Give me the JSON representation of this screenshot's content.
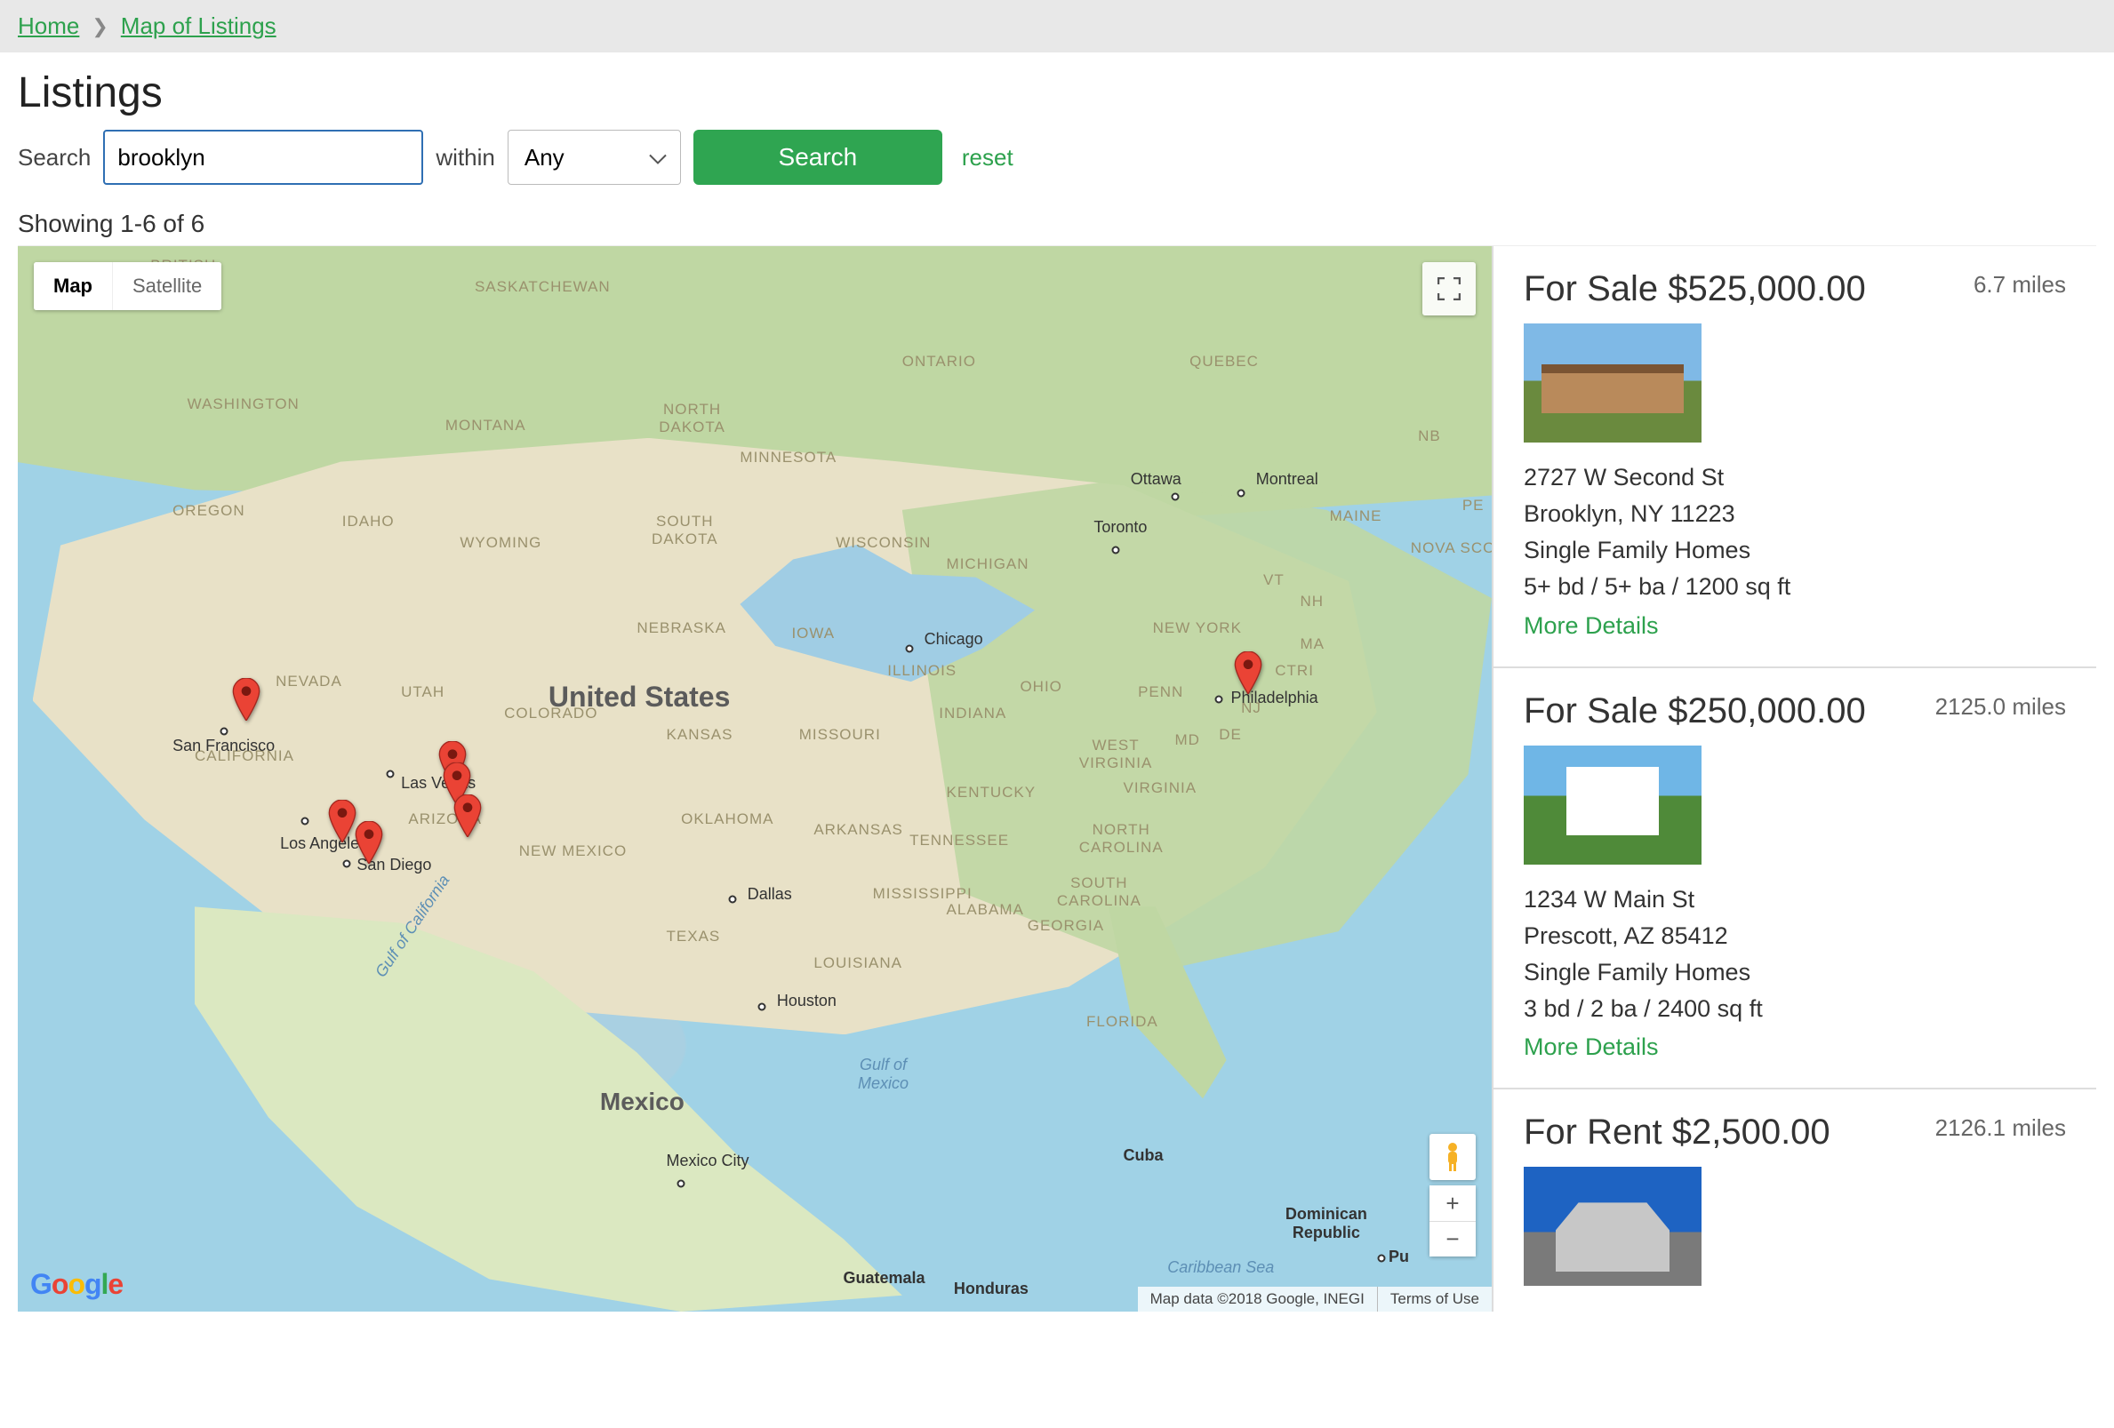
{
  "breadcrumb": {
    "home": "Home",
    "current": "Map of Listings"
  },
  "page_title": "Listings",
  "search": {
    "label": "Search",
    "value": "brooklyn",
    "within_label": "within",
    "within_value": "Any",
    "button": "Search",
    "reset": "reset"
  },
  "result_count": "Showing 1-6 of 6",
  "map": {
    "type_map": "Map",
    "type_sat": "Satellite",
    "attribution": "Map data ©2018 Google, INEGI",
    "terms": "Terms of Use",
    "labels": {
      "british_columbia": "BRITISH\n      BIA",
      "sask": "SASKATCHEWAN",
      "ontario": "ONTARIO",
      "quebec": "QUEBEC",
      "nb": "NB",
      "pe": "PE",
      "maine": "MAINE",
      "nova": "NOVA SCO",
      "wash": "WASHINGTON",
      "mont": "MONTANA",
      "ndak": "NORTH\nDAKOTA",
      "minn": "MINNESOTA",
      "ore": "OREGON",
      "idaho": "IDAHO",
      "wyo": "WYOMING",
      "sdak": "SOUTH\nDAKOTA",
      "wisc": "WISCONSIN",
      "mich": "MICHIGAN",
      "vt": "VT",
      "nh": "NH",
      "ny": "NEW YORK",
      "ma": "MA",
      "ctri": "CTRI",
      "nev": "NEVADA",
      "utah": "UTAH",
      "colo": "COLORADO",
      "neb": "NEBRASKA",
      "iowa": "IOWA",
      "ohio": "OHIO",
      "penn": "PENN",
      "nj": "NJ",
      "de": "DE",
      "cal": "CALIFORNIA",
      "kan": "KANSAS",
      "mo": "MISSOURI",
      "ill": "ILLINOIS",
      "ind": "INDIANA",
      "wv": "WEST\nVIRGINIA",
      "va": "VIRGINIA",
      "md": "MD",
      "ari": "ARIZONA",
      "nm": "NEW MEXICO",
      "ok": "OKLAHOMA",
      "ark": "ARKANSAS",
      "tenn": "TENNESSEE",
      "ky": "KENTUCKY",
      "nc": "NORTH\nCAROLINA",
      "sc": "SOUTH\nCAROLINA",
      "tx": "TEXAS",
      "miss": "MISSISSIPPI",
      "alab": "ALABAMA",
      "ga": "GEORGIA",
      "la": "LOUISIANA",
      "fl": "FLORIDA",
      "usa": "United States",
      "mexico": "Mexico",
      "gulf_mex": "Gulf of\nMexico",
      "gulf_cal": "Gulf of California",
      "carib": "Caribbean Sea",
      "sf": "San Francisco",
      "la_city": "Los Angeles",
      "sd": "San Diego",
      "lv": "Las Vegas",
      "chic": "Chicago",
      "dal": "Dallas",
      "hou": "Houston",
      "phil": "Philadelphia",
      "tor": "Toronto",
      "ott": "Ottawa",
      "mtl": "Montreal",
      "mxc": "Mexico City",
      "cuba": "Cuba",
      "dr": "Dominican\nRepublic",
      "pu": "Pu",
      "guat": "Guatemala",
      "hond": "Honduras"
    }
  },
  "listings": [
    {
      "title": "For Sale $525,000.00",
      "distance": "6.7 miles",
      "addr1": "2727 W Second St",
      "addr2": "Brooklyn, NY 11223",
      "type": "Single Family Homes",
      "stats": "5+ bd / 5+ ba / 1200 sq ft",
      "more": "More Details"
    },
    {
      "title": "For Sale $250,000.00",
      "distance": "2125.0 miles",
      "addr1": "1234 W Main St",
      "addr2": "Prescott, AZ 85412",
      "type": "Single Family Homes",
      "stats": "3 bd / 2 ba / 2400 sq ft",
      "more": "More Details"
    },
    {
      "title": "For Rent $2,500.00",
      "distance": "2126.1 miles",
      "addr1": "",
      "addr2": "",
      "type": "",
      "stats": "",
      "more": ""
    }
  ]
}
